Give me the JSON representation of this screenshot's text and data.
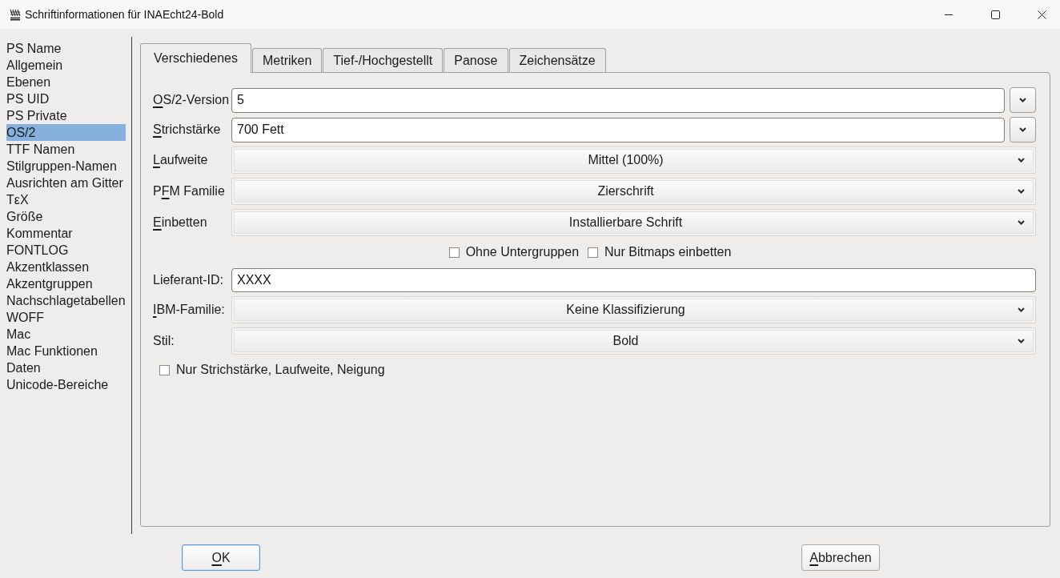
{
  "window": {
    "title": "Schriftinformationen für INAEcht24-Bold"
  },
  "sidebar": {
    "items": [
      {
        "label": "PS Name",
        "selected": false
      },
      {
        "label": "Allgemein",
        "selected": false
      },
      {
        "label": "Ebenen",
        "selected": false
      },
      {
        "label": "PS UID",
        "selected": false
      },
      {
        "label": "PS Private",
        "selected": false
      },
      {
        "label": "OS/2",
        "selected": true
      },
      {
        "label": "TTF Namen",
        "selected": false
      },
      {
        "label": "Stilgruppen-Namen",
        "selected": false
      },
      {
        "label": "Ausrichten am Gitter",
        "selected": false
      },
      {
        "label": "TεX",
        "selected": false
      },
      {
        "label": "Größe",
        "selected": false
      },
      {
        "label": "Kommentar",
        "selected": false
      },
      {
        "label": "FONTLOG",
        "selected": false
      },
      {
        "label": "Akzentklassen",
        "selected": false
      },
      {
        "label": "Akzentgruppen",
        "selected": false
      },
      {
        "label": "Nachschlagetabellen",
        "selected": false
      },
      {
        "label": "WOFF",
        "selected": false
      },
      {
        "label": "Mac",
        "selected": false
      },
      {
        "label": "Mac Funktionen",
        "selected": false
      },
      {
        "label": "Daten",
        "selected": false
      },
      {
        "label": "Unicode-Bereiche",
        "selected": false
      }
    ]
  },
  "tabs": [
    {
      "label": "Verschiedenes",
      "selected": true
    },
    {
      "label": "Metriken",
      "selected": false
    },
    {
      "label": "Tief-/Hochgestellt",
      "selected": false
    },
    {
      "label": "Panose",
      "selected": false
    },
    {
      "label": "Zeichensätze",
      "selected": false
    }
  ],
  "form": {
    "rows": [
      {
        "kind": "editable_combo",
        "label": [
          {
            "text": "O",
            "underlined": true
          },
          {
            "text": "S/2-Version",
            "underlined": false
          }
        ],
        "value": "5"
      },
      {
        "kind": "editable_combo",
        "label": [
          {
            "text": "S",
            "underlined": true
          },
          {
            "text": "trichstärke",
            "underlined": false
          }
        ],
        "value": "700 Fett"
      },
      {
        "kind": "dropdown",
        "label": [
          {
            "text": "L",
            "underlined": true
          },
          {
            "text": "aufweite",
            "underlined": false
          }
        ],
        "value": "Mittel (100%)"
      },
      {
        "kind": "dropdown",
        "label": [
          {
            "text": "P",
            "underlined": false
          },
          {
            "text": "F",
            "underlined": true
          },
          {
            "text": "M Familie",
            "underlined": false
          }
        ],
        "value": "Zierschrift"
      },
      {
        "kind": "dropdown",
        "label": [
          {
            "text": "E",
            "underlined": true
          },
          {
            "text": "inbetten",
            "underlined": false
          }
        ],
        "value": "Installierbare Schrift"
      },
      {
        "kind": "checkbox_group",
        "items": [
          {
            "label": "Ohne Untergruppen",
            "checked": false
          },
          {
            "label": "Nur Bitmaps einbetten",
            "checked": false
          }
        ]
      },
      {
        "kind": "text",
        "label": [
          {
            "text": "Lieferant-ID:",
            "underlined": false
          }
        ],
        "value": "XXXX"
      },
      {
        "kind": "dropdown",
        "label": [
          {
            "text": "I",
            "underlined": true
          },
          {
            "text": "BM-Familie:",
            "underlined": false
          }
        ],
        "value": "Keine Klassifizierung"
      },
      {
        "kind": "dropdown",
        "label": [
          {
            "text": "Stil:",
            "underlined": false
          }
        ],
        "value": "Bold"
      },
      {
        "kind": "checkbox",
        "label": "Nur Strichstärke, Laufweite, Neigung",
        "checked": false
      }
    ]
  },
  "buttons": [
    {
      "label": [
        {
          "text": "O",
          "underlined": true
        },
        {
          "text": "K",
          "underlined": false
        }
      ],
      "focused": true
    },
    {
      "label": [
        {
          "text": "A",
          "underlined": true
        },
        {
          "text": "bbrechen",
          "underlined": false
        }
      ],
      "focused": false
    }
  ]
}
